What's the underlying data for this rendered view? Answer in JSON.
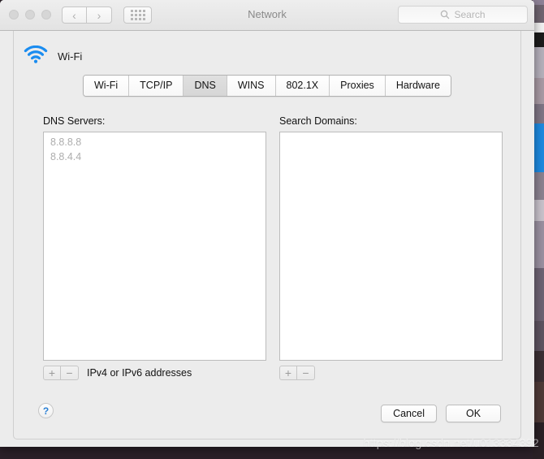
{
  "window": {
    "title": "Network",
    "traffic_lights": [
      "close",
      "minimize",
      "zoom"
    ],
    "nav": {
      "back": "‹",
      "forward": "›"
    },
    "grid_button": "show-all",
    "search": {
      "placeholder": "Search",
      "value": "",
      "icon": "search-icon"
    }
  },
  "sheet": {
    "service": {
      "name": "Wi-Fi",
      "icon": "wifi-icon",
      "color": "#1a8cf0"
    },
    "tabs": [
      {
        "label": "Wi-Fi",
        "selected": false
      },
      {
        "label": "TCP/IP",
        "selected": false
      },
      {
        "label": "DNS",
        "selected": true
      },
      {
        "label": "WINS",
        "selected": false
      },
      {
        "label": "802.1X",
        "selected": false
      },
      {
        "label": "Proxies",
        "selected": false
      },
      {
        "label": "Hardware",
        "selected": false
      }
    ],
    "dns": {
      "label": "DNS Servers:",
      "servers": [
        "8.8.8.8",
        "8.8.4.4"
      ],
      "add_label": "+",
      "remove_label": "−",
      "hint": "IPv4 or IPv6 addresses"
    },
    "search_domains": {
      "label": "Search Domains:",
      "domains": [],
      "add_label": "+",
      "remove_label": "−"
    },
    "footer": {
      "help_label": "?",
      "cancel_label": "Cancel",
      "ok_label": "OK"
    }
  },
  "watermark": "https://blog.csdn.net/u013334392"
}
